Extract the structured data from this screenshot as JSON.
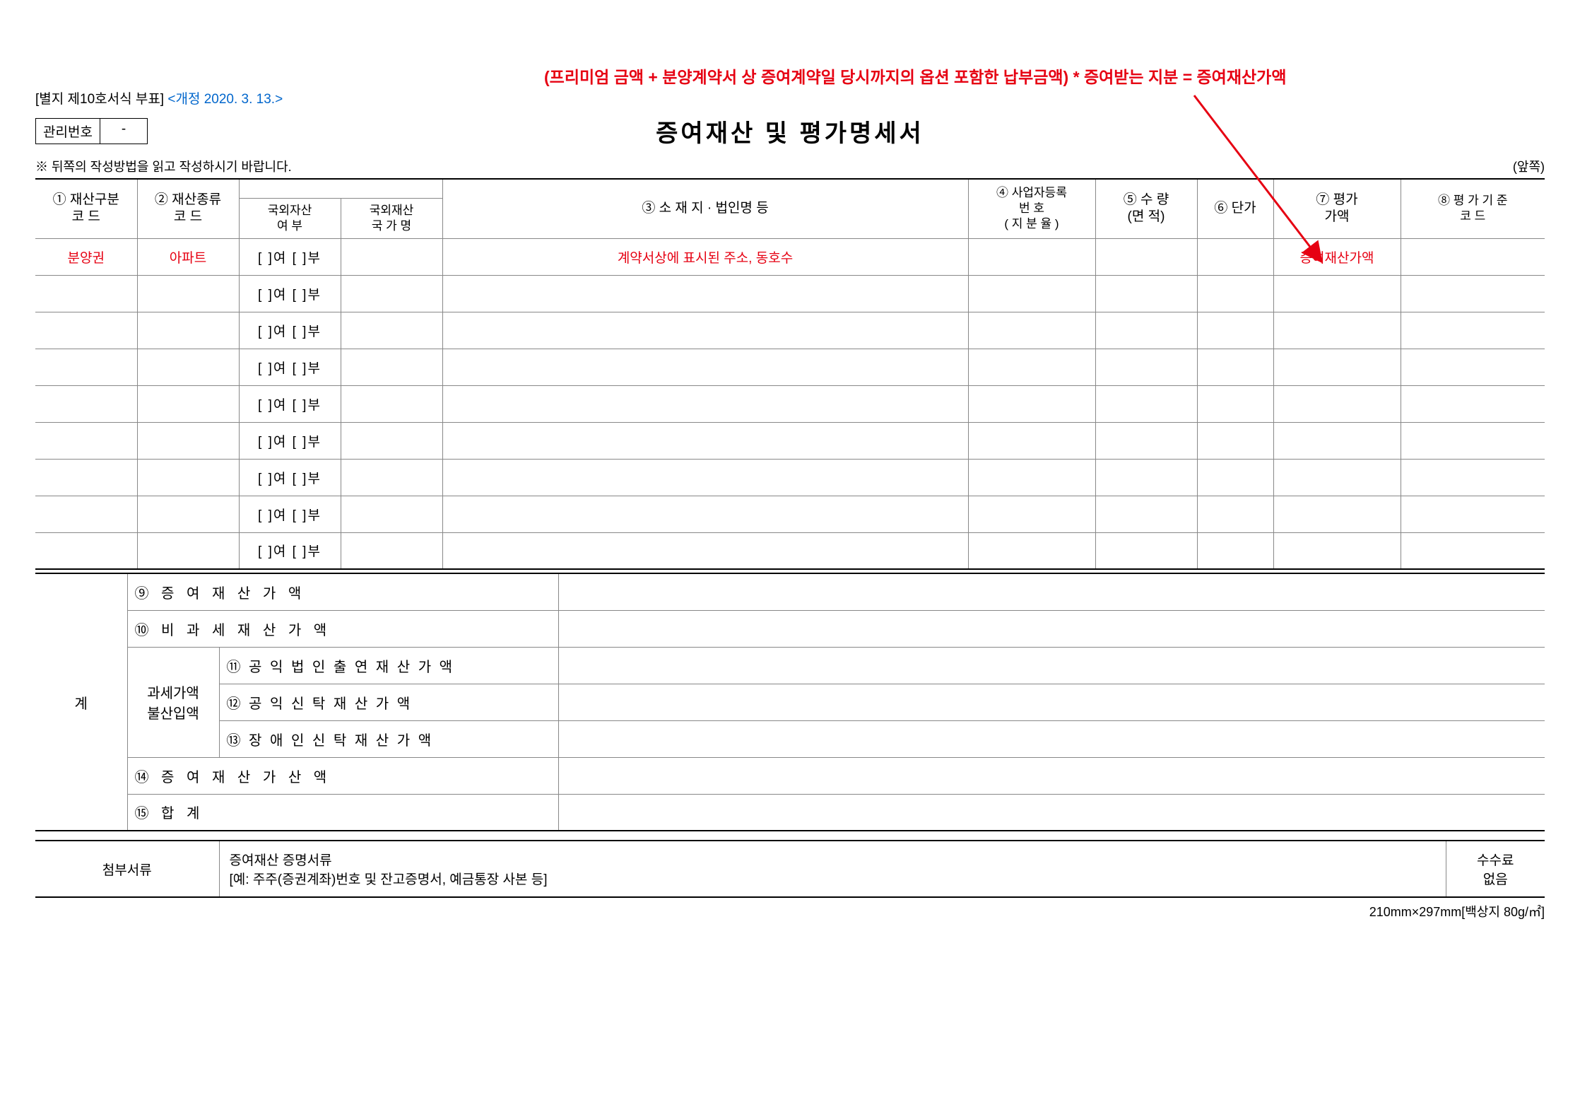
{
  "annotation": "(프리미엄 금액 + 분양계약서 상 증여계약일 당시까지의 옵션 포함한 납부금액) * 증여받는 지분 = 증여재산가액",
  "form_ref": "[별지 제10호서식 부표]",
  "amendment": "<개정 2020. 3. 13.>",
  "mgmt_label": "관리번호",
  "mgmt_value": "-",
  "title": "증여재산  및  평가명세서",
  "instruction": "※ 뒤쪽의 작성방법을 읽고 작성하시기 바랍니다.",
  "page_marker": "(앞쪽)",
  "headers": {
    "h1": "① 재산구분\n코      드",
    "h2": "② 재산종류\n코      드",
    "h2a": "국외자산\n여      부",
    "h2b": "국외재산\n국 가 명",
    "h3": "③ 소 재 지 · 법인명 등",
    "h4": "④ 사업자등록\n번        호\n( 지 분 율 )",
    "h5": "⑤ 수    량\n(면  적)",
    "h6": "⑥ 단가",
    "h7": "⑦  평가\n가액",
    "h8": "⑧  평 가 기 준\n코          드"
  },
  "row1": {
    "c1": "분양권",
    "c2": "아파트",
    "c2a": "[  ]여 [  ]부",
    "c3": "계약서상에 표시된 주소, 동호수",
    "c7": "증여재산가액"
  },
  "yb_text": "[  ]여 [  ]부",
  "calc": {
    "gye": "계",
    "r9": "⑨ 증   여   재   산   가   액",
    "r10": "⑩ 비  과  세  재  산  가  액",
    "rsub_label": "과세가액\n불산입액",
    "r11": "⑪ 공 익 법 인   출 연 재 산 가 액",
    "r12": "⑫ 공 익 신 탁    재 산 가 액",
    "r13": "⑬ 장 애 인   신 탁 재 산 가 액",
    "r14": "⑭ 증  여  재  산  가  산  액",
    "r15": "⑮ 합                        계"
  },
  "attach": {
    "label": "첨부서류",
    "content1": "증여재산 증명서류",
    "content2": "[예: 주주(증권계좌)번호 및 잔고증명서, 예금통장 사본 등]",
    "fee_label": "수수료",
    "fee_value": "없음"
  },
  "paper_spec": "210mm×297mm[백상지 80g/㎡]"
}
